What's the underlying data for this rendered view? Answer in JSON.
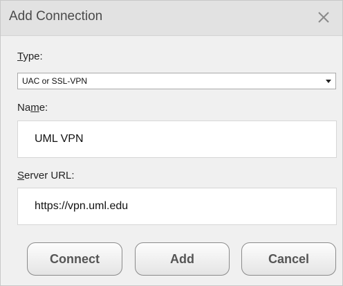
{
  "window": {
    "title": "Add Connection"
  },
  "type_field": {
    "label_first": "T",
    "label_rest": "ype:",
    "selected_value": "UAC or SSL-VPN"
  },
  "name_field": {
    "label_before": "Na",
    "label_underlined": "m",
    "label_after": "e:",
    "value": "UML VPN"
  },
  "server_field": {
    "label_first": "S",
    "label_rest": "erver URL:",
    "value": "https://vpn.uml.edu"
  },
  "buttons": {
    "connect": "Connect",
    "add": "Add",
    "cancel": "Cancel"
  },
  "icons": {
    "close": "close-icon",
    "dropdown": "chevron-down-icon"
  }
}
